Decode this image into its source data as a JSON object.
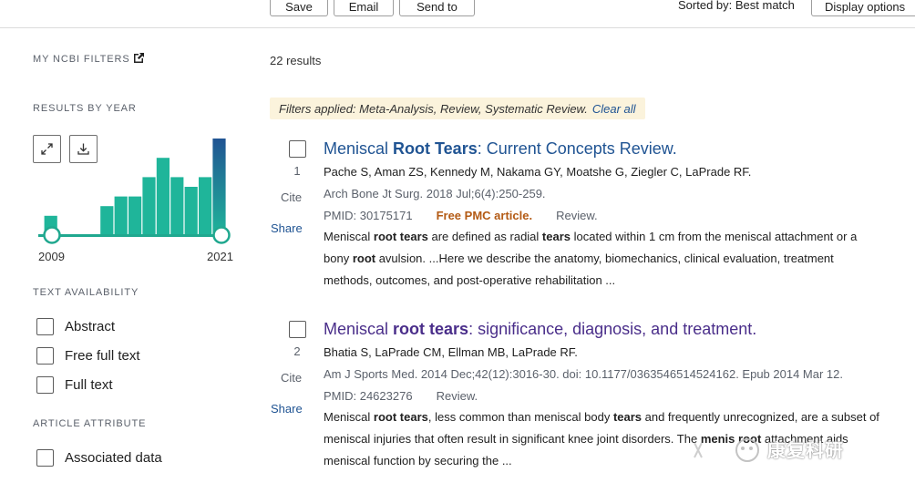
{
  "toolbar": {
    "save_label": "Save",
    "email_label": "Email",
    "sendto_label": "Send to",
    "sorted_label": "Sorted by: Best match",
    "display_label": "Display options"
  },
  "sidebar": {
    "my_filters": "MY NCBI FILTERS",
    "results_by_year": "RESULTS BY YEAR",
    "year_start": "2009",
    "year_end": "2021",
    "text_availability": "TEXT AVAILABILITY",
    "text_options": [
      "Abstract",
      "Free full text",
      "Full text"
    ],
    "article_attribute": "ARTICLE ATTRIBUTE",
    "attribute_options": [
      "Associated data"
    ]
  },
  "chart_data": {
    "type": "bar",
    "categories": [
      "2009",
      "2010",
      "2011",
      "2012",
      "2013",
      "2014",
      "2015",
      "2016",
      "2017",
      "2018",
      "2019",
      "2020",
      "2021"
    ],
    "values": [
      2,
      0,
      0,
      0,
      3,
      4,
      4,
      6,
      8,
      6,
      5,
      6,
      10
    ],
    "colors": {
      "bar": "#1fb59a",
      "bar_last": "#205493",
      "handle": "#20a88f"
    }
  },
  "main": {
    "count": "22 results",
    "filters_text": "Filters applied: Meta-Analysis, Review, Systematic Review.",
    "clear_label": "Clear all"
  },
  "results": [
    {
      "num": "1",
      "cite": "Cite",
      "share": "Share",
      "title_pre": "Meniscal ",
      "title_hl": "Root Tears",
      "title_post": ": Current Concepts Review.",
      "authors": "Pache S, Aman ZS, Kennedy M, Nakama GY, Moatshe G, Ziegler C, LaPrade RF.",
      "journal": "Arch Bone Jt Surg. 2018 Jul;6(4):250-259.",
      "pmid": "PMID: 30175171",
      "free": "Free PMC article.",
      "ptype": "Review.",
      "snippet": [
        [
          "Meniscal ",
          ""
        ],
        [
          "root tears",
          "b"
        ],
        [
          " are defined as radial ",
          ""
        ],
        [
          "tears",
          "b"
        ],
        [
          " located within 1 cm from the meniscal attachment or a",
          ""
        ]
      ],
      "snippet2": [
        [
          "bony ",
          ""
        ],
        [
          "root",
          "b"
        ],
        [
          " avulsion. ...Here we describe the anatomy, biomechanics, clinical evaluation, treatment",
          ""
        ]
      ],
      "snippet3": "methods, outcomes, and post-operative rehabilitation ..."
    },
    {
      "num": "2",
      "cite": "Cite",
      "share": "Share",
      "title_pre": "Meniscal ",
      "title_hl": "root tears",
      "title_post": ": significance, diagnosis, and treatment.",
      "authors": "Bhatia S, LaPrade CM, Ellman MB, LaPrade RF.",
      "journal": "Am J Sports Med. 2014 Dec;42(12):3016-30. doi: 10.1177/0363546514524162. Epub 2014 Mar 12.",
      "pmid": "PMID: 24623276",
      "ptype": "Review.",
      "snippet": [
        [
          "Meniscal ",
          ""
        ],
        [
          "root tears",
          "b"
        ],
        [
          ", less common than meniscal body ",
          ""
        ],
        [
          "tears",
          "b"
        ],
        [
          " and frequently unrecognized, are a subset of",
          ""
        ]
      ],
      "snippet2": [
        [
          "meniscal injuries that often result in significant knee joint disorders. The ",
          ""
        ],
        [
          "menis",
          "b"
        ],
        [
          "   ",
          ""
        ],
        [
          "root",
          "b"
        ],
        [
          " attachment aids",
          ""
        ]
      ],
      "snippet3": "meniscal function by securing the ..."
    }
  ],
  "watermark": {
    "text": "康复科研"
  }
}
